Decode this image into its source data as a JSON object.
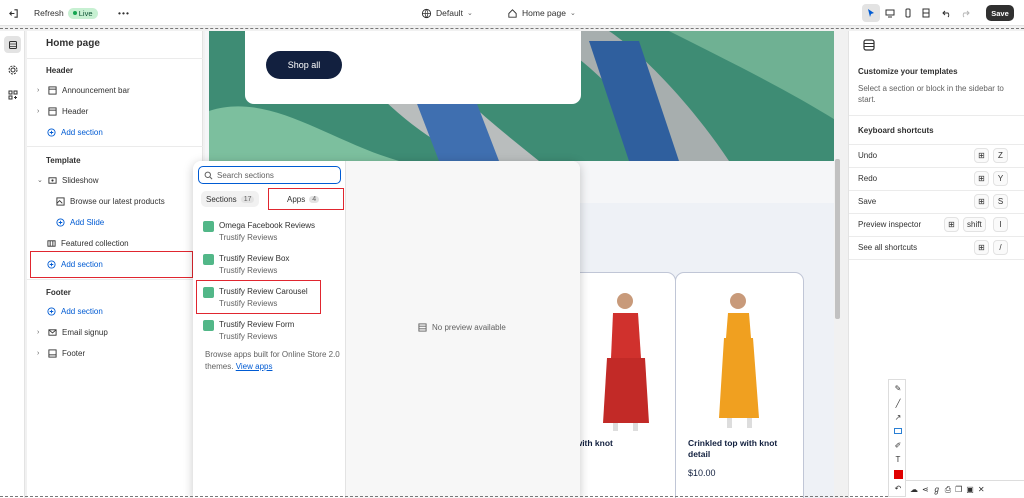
{
  "topbar": {
    "refresh_label": "Refresh",
    "live_label": "Live",
    "more": "•••",
    "theme_label": "Default",
    "page_label": "Home page",
    "save_label": "Save"
  },
  "sidebar": {
    "title": "Home page",
    "header_heading": "Header",
    "announcement_bar": "Announcement bar",
    "header": "Header",
    "add_section": "Add section",
    "template_heading": "Template",
    "slideshow": "Slideshow",
    "browse_products": "Browse our latest products",
    "add_slide": "Add Slide",
    "featured_collection": "Featured collection",
    "add_section_template": "Add section",
    "footer_heading": "Footer",
    "add_section_footer": "Add section",
    "email_signup": "Email signup",
    "footer": "Footer"
  },
  "preview": {
    "shop_all": "Shop all",
    "products": [
      {
        "name": "top with knot",
        "price": ""
      },
      {
        "name": "Crinkled top with knot detail",
        "price": "$10.00"
      }
    ]
  },
  "picker": {
    "search_placeholder": "Search sections",
    "tab_sections": "Sections",
    "tab_sections_count": "17",
    "tab_apps": "Apps",
    "tab_apps_count": "4",
    "apps": [
      {
        "name": "Omega Facebook Reviews",
        "vendor": "Trustify Reviews"
      },
      {
        "name": "Trustify Review Box",
        "vendor": "Trustify Reviews"
      },
      {
        "name": "Trustify Review Carousel",
        "vendor": "Trustify Reviews"
      },
      {
        "name": "Trustify Review Form",
        "vendor": "Trustify Reviews"
      }
    ],
    "browse_text": "Browse apps built for Online Store 2.0 themes.",
    "view_apps": "View apps",
    "no_preview": "No preview available"
  },
  "right_panel": {
    "customize_title": "Customize your templates",
    "customize_desc": "Select a section or block in the sidebar to start.",
    "shortcuts_title": "Keyboard shortcuts",
    "shortcuts": [
      {
        "label": "Undo",
        "keys": [
          "⊞",
          "Z"
        ]
      },
      {
        "label": "Redo",
        "keys": [
          "⊞",
          "Y"
        ]
      },
      {
        "label": "Save",
        "keys": [
          "⊞",
          "S"
        ]
      },
      {
        "label": "Preview inspector",
        "keys": [
          "⊞",
          "shift",
          "I"
        ]
      },
      {
        "label": "See all shortcuts",
        "keys": [
          "⊞",
          "/"
        ]
      }
    ]
  },
  "colors": {
    "accent_blue": "#005bd3",
    "highlight_red": "#e0262f",
    "button_navy": "#12203f"
  }
}
